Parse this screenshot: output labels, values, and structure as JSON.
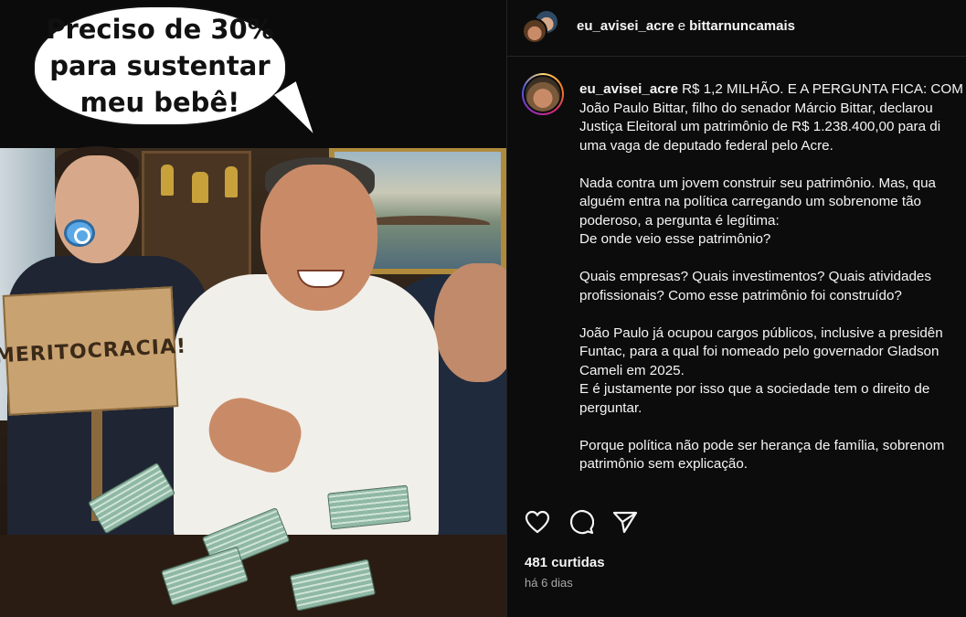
{
  "image": {
    "speech_bubble": [
      "Preciso de 30%",
      "para sustentar",
      "meu bebê!"
    ],
    "sign_text": "MERITOCRACIA!"
  },
  "header": {
    "user1": "eu_avisei_acre",
    "connector": "e",
    "user2": "bittarnuncamais"
  },
  "caption": {
    "username": "eu_avisei_acre",
    "lines": [
      "R$ 1,2 MILHÃO. E A PERGUNTA FICA: COM",
      "João Paulo Bittar, filho do senador Márcio Bittar, declarou",
      "Justiça Eleitoral um patrimônio de R$ 1.238.400,00 para di",
      "uma vaga de deputado federal pelo Acre.",
      "",
      "Nada contra um jovem construir seu patrimônio. Mas, qua",
      "alguém entra na política carregando um sobrenome tão",
      "poderoso, a pergunta é legítima:",
      "De onde veio esse patrimônio?",
      "",
      "Quais empresas? Quais investimentos? Quais atividades",
      "profissionais? Como esse patrimônio foi construído?",
      "",
      "João Paulo já ocupou cargos públicos, inclusive a presidên",
      "Funtac, para a qual foi nomeado pelo governador Gladson",
      "Cameli em 2025.",
      "E é justamente por isso que a sociedade tem o direito de",
      "perguntar.",
      "",
      "Porque política não pode ser herança de família, sobrenom",
      "patrimônio sem explicação."
    ]
  },
  "actions": {
    "like_icon": "heart-icon",
    "comment_icon": "comment-icon",
    "share_icon": "send-icon"
  },
  "likes": "481 curtidas",
  "date": "há 6 dias",
  "colors": {
    "background": "#0c0c0d",
    "text": "#f5f5f5",
    "muted": "#a8a8a8"
  }
}
